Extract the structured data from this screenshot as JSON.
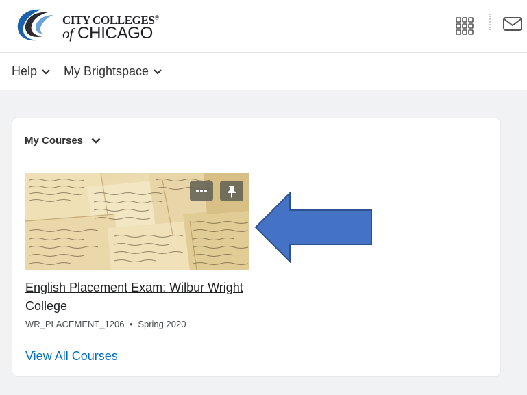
{
  "header": {
    "logo": {
      "line1": "CITY COLLEGES",
      "line2_of": "of",
      "line2_city": "CHICAGO",
      "mark": "®"
    },
    "icons": {
      "apps": "grid-icon",
      "messages": "mail-icon"
    }
  },
  "nav": {
    "items": [
      {
        "label": "Help"
      },
      {
        "label": "My Brightspace"
      }
    ]
  },
  "widget": {
    "title": "My Courses",
    "course": {
      "title": "English Placement Exam: Wilbur Wright College",
      "code": "WR_PLACEMENT_1206",
      "separator": "•",
      "term": "Spring 2020"
    },
    "view_all_label": "View All Courses"
  },
  "colors": {
    "link": "#006fbf",
    "arrow_fill": "#4472c4",
    "arrow_stroke": "#2f528f",
    "logo_blue": "#1a62ad"
  }
}
